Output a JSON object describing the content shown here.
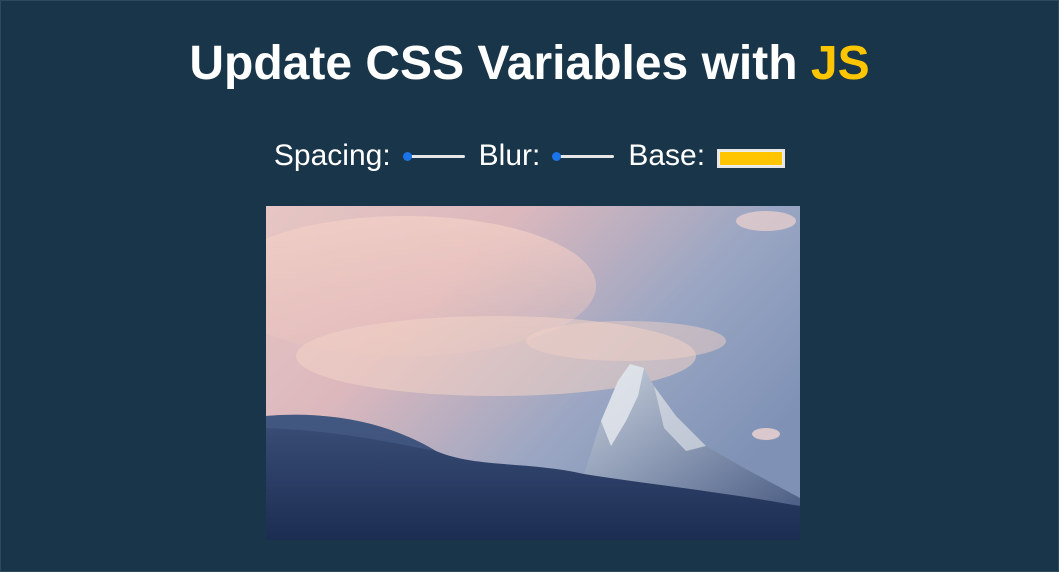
{
  "title": {
    "main": "Update CSS Variables with ",
    "highlight": "JS"
  },
  "controls": {
    "spacing": {
      "label": "Spacing:",
      "value": 0
    },
    "blur": {
      "label": "Blur:",
      "value": 0
    },
    "base": {
      "label": "Base:",
      "value": "#ffc600"
    }
  },
  "image": {
    "subject": "mountain-peak-photo"
  },
  "colors": {
    "background": "#193549",
    "accent": "#ffc600",
    "text": "#ffffff"
  }
}
